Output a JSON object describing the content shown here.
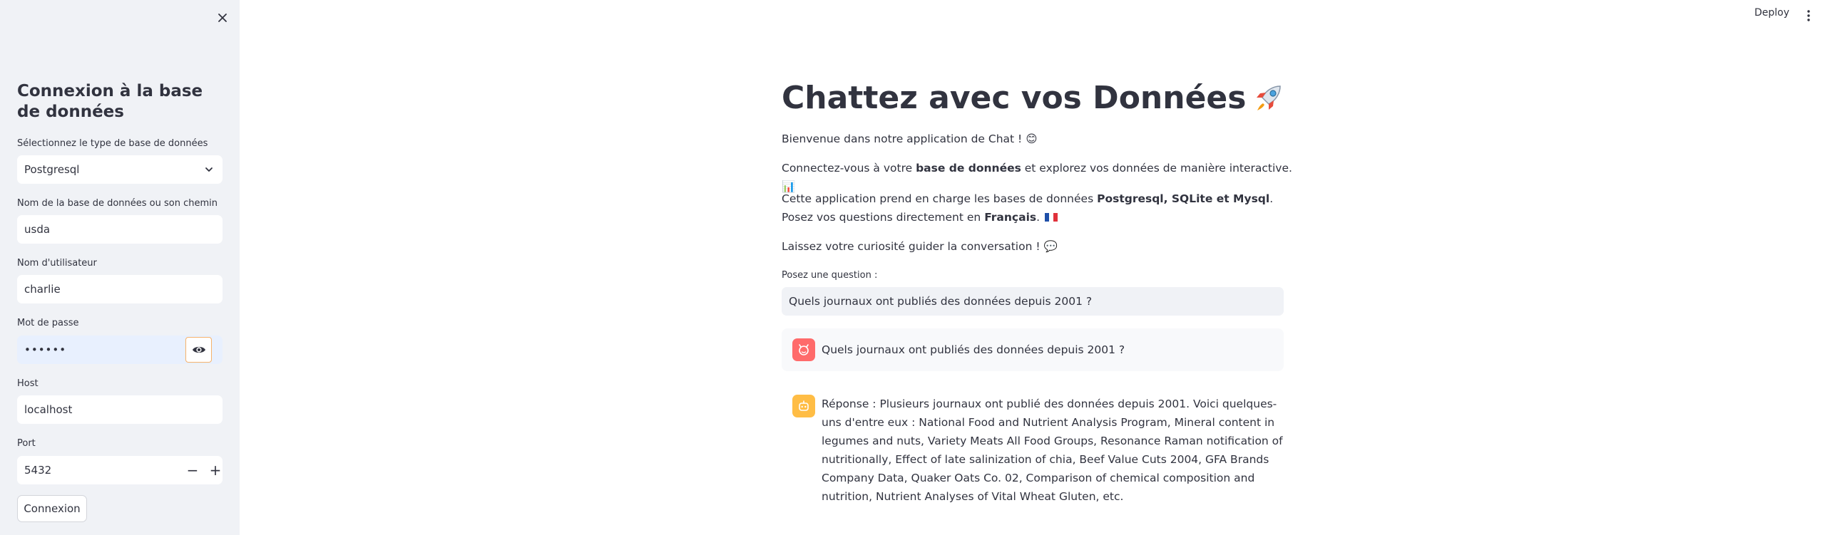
{
  "sidebar": {
    "title": "Connexion à la base de données",
    "db_type": {
      "label": "Sélectionnez le type de base de données",
      "value": "Postgresql"
    },
    "db_name": {
      "label": "Nom de la base de données ou son chemin",
      "value": "usda"
    },
    "username": {
      "label": "Nom d'utilisateur",
      "value": "charlie"
    },
    "password": {
      "label": "Mot de passe",
      "value": "••••••"
    },
    "host": {
      "label": "Host",
      "value": "localhost"
    },
    "port": {
      "label": "Port",
      "value": "5432",
      "decrement": "−",
      "increment": "+"
    },
    "connect_button": "Connexion"
  },
  "topbar": {
    "deploy_label": "Deploy"
  },
  "main": {
    "title": "Chattez avec vos Données",
    "welcome": {
      "text": "Bienvenue dans notre application de Chat !",
      "emoji": "😊"
    },
    "connect": {
      "pre": "Connectez-vous à votre ",
      "bold": "base de données",
      "post": " et explorez vos données de manière interactive.",
      "emoji": "📊"
    },
    "support": {
      "pre": "Cette application prend en charge les bases de données ",
      "bold": "Postgresql, SQLite et Mysql",
      "mid": ". Posez vos questions directement en ",
      "bold2": "Français",
      "post": "."
    },
    "curiosity": {
      "text": "Laissez votre curiosité guider la conversation !",
      "emoji": "💬"
    },
    "question_label": "Posez une question :",
    "question_value": "Quels journaux ont publiés des données depuis 2001 ?",
    "user_message": "Quels journaux ont publiés des données depuis 2001 ?",
    "bot_message": "Réponse : Plusieurs journaux ont publié des données depuis 2001. Voici quelques-uns d'entre eux : National Food and Nutrient Analysis Program, Mineral content in legumes and nuts, Variety Meats All Food Groups, Resonance Raman notification of nutritionally, Effect of late salinization of chia, Beef Value Cuts 2004, GFA Brands Company Data, Quaker Oats Co. 02, Comparison of chemical composition and nutrition, Nutrient Analyses of Vital Wheat Gluten, etc."
  },
  "colors": {
    "sidebar_bg": "#f0f2f6",
    "text": "#31333f",
    "user_avatar": "#ff6b6b",
    "bot_avatar": "#ffbd45",
    "eye_button_border": "#f6b26b"
  },
  "icons": {
    "close": "close-icon",
    "chevron": "chevron-down-icon",
    "eye": "eye-icon",
    "kebab": "more-vertical-icon",
    "rocket": "rocket-emoji",
    "user_avatar": "user-avatar-icon",
    "bot_avatar": "bot-avatar-icon",
    "flag": "france-flag-icon"
  }
}
